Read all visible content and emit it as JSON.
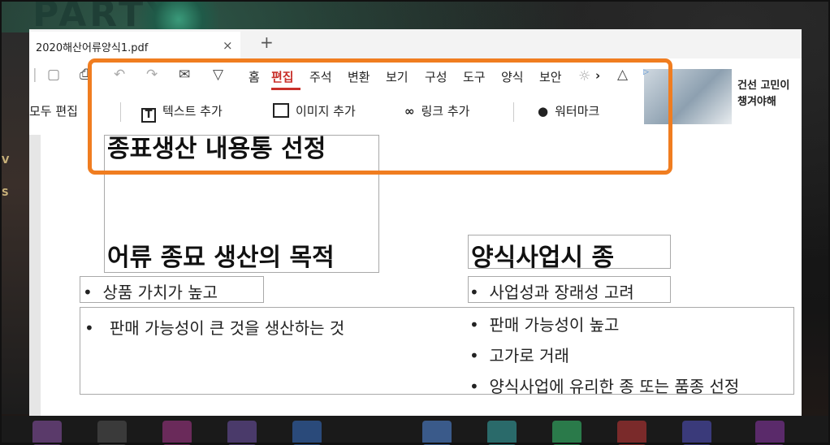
{
  "background": {
    "text": "PARTY"
  },
  "tab": {
    "title": "2020해산어류양식1.pdf",
    "close": "×",
    "new_tab": "+"
  },
  "menu": {
    "items": [
      "홈",
      "편집",
      "주석",
      "변환",
      "보기",
      "구성",
      "도구",
      "양식",
      "보안"
    ],
    "active": "편집",
    "more": "›"
  },
  "edit_toolbar": {
    "edit_all": "모두 편집",
    "add_text": "텍스트 추가",
    "add_image": "이미지 추가",
    "add_link": "링크 추가",
    "watermark": "워터마크"
  },
  "ad": {
    "line1": "건선 고민이",
    "line2": "챙겨야해",
    "mark": "▷"
  },
  "document": {
    "clipped_heading": "종표생산 내용통 선정",
    "heading1": "어류 종묘 생산의 목적",
    "heading2": "양식사업시 종",
    "left_bullets": [
      "상품 가치가 높고",
      "판매 가능성이 큰 것을 생산하는 것"
    ],
    "right_bullets": [
      "사업성과 장래성 고려",
      "판매 가능성이 높고",
      "고가로 거래",
      "양식사업에 유리한 종 또는 품종 선정"
    ]
  },
  "colors": {
    "accent": "#c8302a",
    "highlight": "#f07d20"
  }
}
